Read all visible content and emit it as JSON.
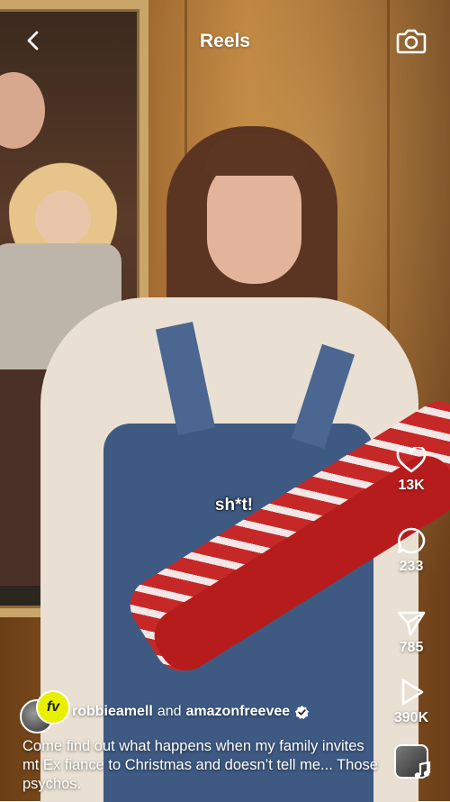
{
  "header": {
    "title": "Reels",
    "back_icon": "chevron-left-icon",
    "camera_icon": "camera-icon"
  },
  "video": {
    "subtitle_word": "sh*t!"
  },
  "actions": {
    "like": {
      "icon": "heart-icon",
      "count": "13K"
    },
    "comment": {
      "icon": "comment-icon",
      "count": "233"
    },
    "share": {
      "icon": "send-icon",
      "count": "785"
    },
    "plays": {
      "icon": "play-icon",
      "count": "390K"
    }
  },
  "post": {
    "author_primary": "robbieamell",
    "connector": "and",
    "author_secondary": "amazonfreevee",
    "verified": true,
    "avatar_badge": "fv",
    "caption": "Come find out what happens when my family invites mt Ex fiance to Christmas and doesn’t tell me... Those psychos.",
    "music_icon": "music-note-icon"
  },
  "colors": {
    "text": "#ffffff",
    "verified": "#ffffff",
    "avatar_badge_bg": "#e8f000"
  }
}
